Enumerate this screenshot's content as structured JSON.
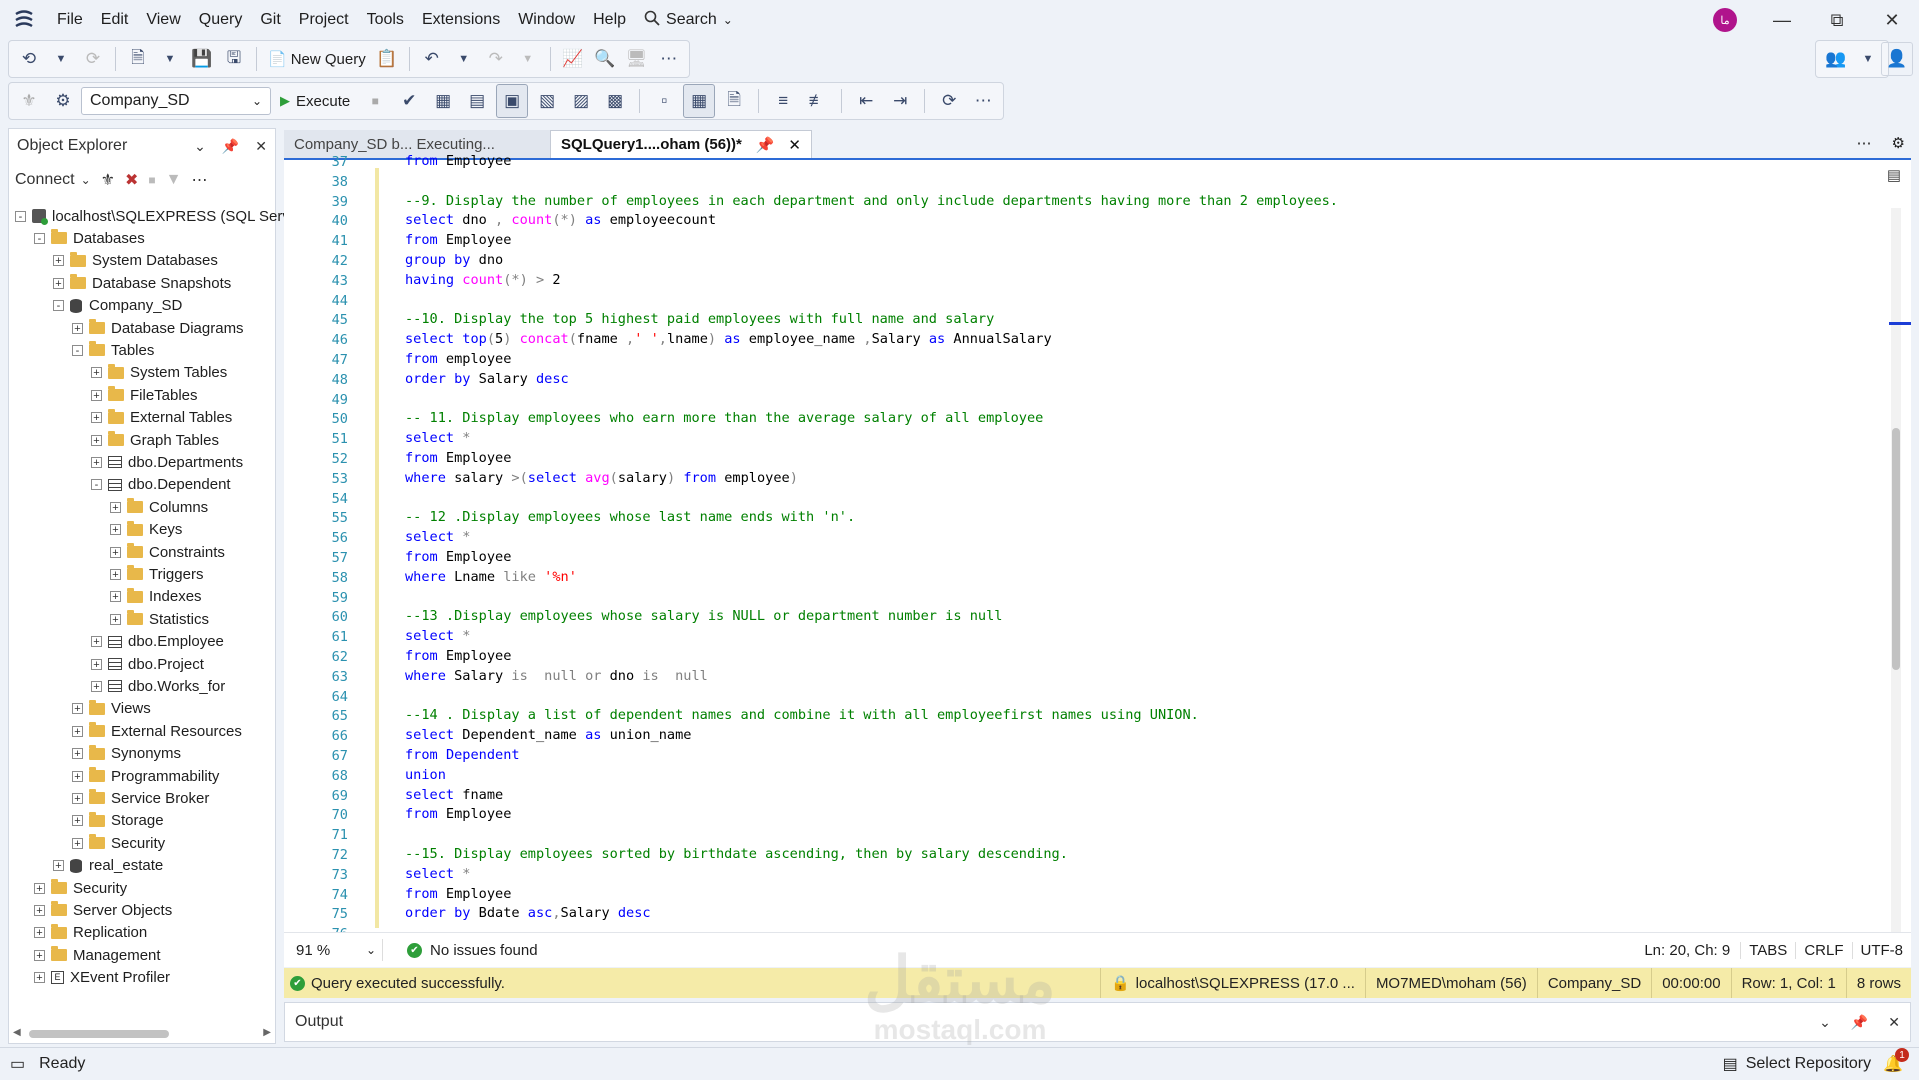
{
  "menu": {
    "items": [
      "File",
      "Edit",
      "View",
      "Query",
      "Git",
      "Project",
      "Tools",
      "Extensions",
      "Window",
      "Help"
    ],
    "search_label": "Search"
  },
  "user": {
    "avatar_initials": "ما"
  },
  "toolbar": {
    "new_query_label": "New Query",
    "database_selected": "Company_SD",
    "execute_label": "Execute"
  },
  "object_explorer": {
    "title": "Object Explorer",
    "connect_label": "Connect",
    "tree": [
      {
        "label": "localhost\\SQLEXPRESS (SQL Serve",
        "icon": "server-icon",
        "level": 0,
        "state": "-"
      },
      {
        "label": "Databases",
        "icon": "folder-icon",
        "level": 1,
        "state": "-"
      },
      {
        "label": "System Databases",
        "icon": "folder-icon",
        "level": 2,
        "state": "+"
      },
      {
        "label": "Database Snapshots",
        "icon": "folder-icon",
        "level": 2,
        "state": "+"
      },
      {
        "label": "Company_SD",
        "icon": "database-icon",
        "level": 2,
        "state": "-"
      },
      {
        "label": "Database Diagrams",
        "icon": "folder-icon",
        "level": 3,
        "state": "+"
      },
      {
        "label": "Tables",
        "icon": "folder-icon",
        "level": 3,
        "state": "-"
      },
      {
        "label": "System Tables",
        "icon": "folder-icon",
        "level": 4,
        "state": "+"
      },
      {
        "label": "FileTables",
        "icon": "folder-icon",
        "level": 4,
        "state": "+"
      },
      {
        "label": "External Tables",
        "icon": "folder-icon",
        "level": 4,
        "state": "+"
      },
      {
        "label": "Graph Tables",
        "icon": "folder-icon",
        "level": 4,
        "state": "+"
      },
      {
        "label": "dbo.Departments",
        "icon": "table-icon",
        "level": 4,
        "state": "+"
      },
      {
        "label": "dbo.Dependent",
        "icon": "table-icon",
        "level": 4,
        "state": "-"
      },
      {
        "label": "Columns",
        "icon": "folder-icon",
        "level": 5,
        "state": "+"
      },
      {
        "label": "Keys",
        "icon": "folder-icon",
        "level": 5,
        "state": "+"
      },
      {
        "label": "Constraints",
        "icon": "folder-icon",
        "level": 5,
        "state": "+"
      },
      {
        "label": "Triggers",
        "icon": "folder-icon",
        "level": 5,
        "state": "+"
      },
      {
        "label": "Indexes",
        "icon": "folder-icon",
        "level": 5,
        "state": "+"
      },
      {
        "label": "Statistics",
        "icon": "folder-icon",
        "level": 5,
        "state": "+"
      },
      {
        "label": "dbo.Employee",
        "icon": "table-icon",
        "level": 4,
        "state": "+"
      },
      {
        "label": "dbo.Project",
        "icon": "table-icon",
        "level": 4,
        "state": "+"
      },
      {
        "label": "dbo.Works_for",
        "icon": "table-icon",
        "level": 4,
        "state": "+"
      },
      {
        "label": "Views",
        "icon": "folder-icon",
        "level": 3,
        "state": "+"
      },
      {
        "label": "External Resources",
        "icon": "folder-icon",
        "level": 3,
        "state": "+"
      },
      {
        "label": "Synonyms",
        "icon": "folder-icon",
        "level": 3,
        "state": "+"
      },
      {
        "label": "Programmability",
        "icon": "folder-icon",
        "level": 3,
        "state": "+"
      },
      {
        "label": "Service Broker",
        "icon": "folder-icon",
        "level": 3,
        "state": "+"
      },
      {
        "label": "Storage",
        "icon": "folder-icon",
        "level": 3,
        "state": "+"
      },
      {
        "label": "Security",
        "icon": "folder-icon",
        "level": 3,
        "state": "+"
      },
      {
        "label": "real_estate",
        "icon": "database-icon",
        "level": 2,
        "state": "+"
      },
      {
        "label": "Security",
        "icon": "folder-icon",
        "level": 1,
        "state": "+"
      },
      {
        "label": "Server Objects",
        "icon": "folder-icon",
        "level": 1,
        "state": "+"
      },
      {
        "label": "Replication",
        "icon": "folder-icon",
        "level": 1,
        "state": "+"
      },
      {
        "label": "Management",
        "icon": "folder-icon",
        "level": 1,
        "state": "+"
      },
      {
        "label": "XEvent Profiler",
        "icon": "xevent-icon",
        "level": 1,
        "state": "+"
      }
    ]
  },
  "tabs": [
    {
      "label": "Company_SD b... Executing...",
      "active": false
    },
    {
      "label": "SQLQuery1....oham (56))*",
      "active": true
    }
  ],
  "editor": {
    "lines": [
      {
        "n": 37,
        "tokens": [
          [
            "kw",
            "from"
          ],
          [
            "t",
            " Employee"
          ]
        ]
      },
      {
        "n": 38,
        "tokens": []
      },
      {
        "n": 39,
        "tokens": [
          [
            "cm",
            "--9. Display the number of employees in each department and only include departments having more than 2 employees."
          ]
        ]
      },
      {
        "n": 40,
        "tokens": [
          [
            "kw",
            "select"
          ],
          [
            "t",
            " dno "
          ],
          [
            "gr",
            ","
          ],
          [
            "t",
            " "
          ],
          [
            "fn",
            "count"
          ],
          [
            "gr",
            "(*)"
          ],
          [
            "t",
            " "
          ],
          [
            "kw",
            "as"
          ],
          [
            "t",
            " employeecount"
          ]
        ]
      },
      {
        "n": 41,
        "tokens": [
          [
            "kw",
            "from"
          ],
          [
            "t",
            " Employee"
          ]
        ]
      },
      {
        "n": 42,
        "tokens": [
          [
            "kw",
            "group by"
          ],
          [
            "t",
            " dno"
          ]
        ]
      },
      {
        "n": 43,
        "tokens": [
          [
            "kw",
            "having"
          ],
          [
            "t",
            " "
          ],
          [
            "fn",
            "count"
          ],
          [
            "gr",
            "(*)"
          ],
          [
            "t",
            " "
          ],
          [
            "gr",
            ">"
          ],
          [
            "t",
            " 2"
          ]
        ]
      },
      {
        "n": 44,
        "tokens": []
      },
      {
        "n": 45,
        "tokens": [
          [
            "cm",
            "--10. Display the top 5 highest paid employees with full name and salary"
          ]
        ]
      },
      {
        "n": 46,
        "tokens": [
          [
            "kw",
            "select"
          ],
          [
            "t",
            " "
          ],
          [
            "kw",
            "top"
          ],
          [
            "gr",
            "("
          ],
          [
            "t",
            "5"
          ],
          [
            "gr",
            ")"
          ],
          [
            "t",
            " "
          ],
          [
            "fn",
            "concat"
          ],
          [
            "gr",
            "("
          ],
          [
            "t",
            "fname "
          ],
          [
            "gr",
            ","
          ],
          [
            "str",
            "' '"
          ],
          [
            "gr",
            ","
          ],
          [
            "t",
            "lname"
          ],
          [
            "gr",
            ")"
          ],
          [
            "t",
            " "
          ],
          [
            "kw",
            "as"
          ],
          [
            "t",
            " employee_name "
          ],
          [
            "gr",
            ","
          ],
          [
            "t",
            "Salary "
          ],
          [
            "kw",
            "as"
          ],
          [
            "t",
            " AnnualSalary"
          ]
        ]
      },
      {
        "n": 47,
        "tokens": [
          [
            "kw",
            "from"
          ],
          [
            "t",
            " employee"
          ]
        ]
      },
      {
        "n": 48,
        "tokens": [
          [
            "kw",
            "order by"
          ],
          [
            "t",
            " Salary "
          ],
          [
            "kw",
            "desc"
          ]
        ]
      },
      {
        "n": 49,
        "tokens": []
      },
      {
        "n": 50,
        "tokens": [
          [
            "cm",
            "-- 11. Display employees who earn more than the average salary of all employee"
          ]
        ]
      },
      {
        "n": 51,
        "tokens": [
          [
            "kw",
            "select"
          ],
          [
            "t",
            " "
          ],
          [
            "gr",
            "*"
          ]
        ]
      },
      {
        "n": 52,
        "tokens": [
          [
            "kw",
            "from"
          ],
          [
            "t",
            " Employee"
          ]
        ]
      },
      {
        "n": 53,
        "tokens": [
          [
            "kw",
            "where"
          ],
          [
            "t",
            " salary "
          ],
          [
            "gr",
            ">("
          ],
          [
            "kw",
            "select"
          ],
          [
            "t",
            " "
          ],
          [
            "fn",
            "avg"
          ],
          [
            "gr",
            "("
          ],
          [
            "t",
            "salary"
          ],
          [
            "gr",
            ")"
          ],
          [
            "t",
            " "
          ],
          [
            "kw",
            "from"
          ],
          [
            "t",
            " employee"
          ],
          [
            "gr",
            ")"
          ]
        ]
      },
      {
        "n": 54,
        "tokens": []
      },
      {
        "n": 55,
        "tokens": [
          [
            "cm",
            "-- 12 .Display employees whose last name ends with 'n'."
          ]
        ]
      },
      {
        "n": 56,
        "tokens": [
          [
            "kw",
            "select"
          ],
          [
            "t",
            " "
          ],
          [
            "gr",
            "*"
          ]
        ]
      },
      {
        "n": 57,
        "tokens": [
          [
            "kw",
            "from"
          ],
          [
            "t",
            " Employee"
          ]
        ]
      },
      {
        "n": 58,
        "tokens": [
          [
            "kw",
            "where"
          ],
          [
            "t",
            " Lname "
          ],
          [
            "gr",
            "like"
          ],
          [
            "t",
            " "
          ],
          [
            "str",
            "'%n'"
          ]
        ]
      },
      {
        "n": 59,
        "tokens": []
      },
      {
        "n": 60,
        "tokens": [
          [
            "cm",
            "--13 .Display employees whose salary is NULL or department number is null"
          ]
        ]
      },
      {
        "n": 61,
        "tokens": [
          [
            "kw",
            "select"
          ],
          [
            "t",
            " "
          ],
          [
            "gr",
            "*"
          ]
        ]
      },
      {
        "n": 62,
        "tokens": [
          [
            "kw",
            "from"
          ],
          [
            "t",
            " Employee"
          ]
        ]
      },
      {
        "n": 63,
        "tokens": [
          [
            "kw",
            "where"
          ],
          [
            "t",
            " Salary "
          ],
          [
            "gr",
            "is  null or"
          ],
          [
            "t",
            " dno "
          ],
          [
            "gr",
            "is  null"
          ]
        ]
      },
      {
        "n": 64,
        "tokens": []
      },
      {
        "n": 65,
        "tokens": [
          [
            "cm",
            "--14 . Display a list of dependent names and combine it with all employeefirst names using UNION."
          ]
        ]
      },
      {
        "n": 66,
        "tokens": [
          [
            "kw",
            "select"
          ],
          [
            "t",
            " Dependent_name "
          ],
          [
            "kw",
            "as"
          ],
          [
            "t",
            " union_name"
          ]
        ]
      },
      {
        "n": 67,
        "tokens": [
          [
            "kw",
            "from"
          ],
          [
            "t",
            " "
          ],
          [
            "kw",
            "Dependent"
          ]
        ]
      },
      {
        "n": 68,
        "tokens": [
          [
            "kw",
            "union"
          ]
        ]
      },
      {
        "n": 69,
        "tokens": [
          [
            "kw",
            "select"
          ],
          [
            "t",
            " fname"
          ]
        ]
      },
      {
        "n": 70,
        "tokens": [
          [
            "kw",
            "from"
          ],
          [
            "t",
            " Employee"
          ]
        ]
      },
      {
        "n": 71,
        "tokens": []
      },
      {
        "n": 72,
        "tokens": [
          [
            "cm",
            "--15. Display employees sorted by birthdate ascending, then by salary descending."
          ]
        ]
      },
      {
        "n": 73,
        "tokens": [
          [
            "kw",
            "select"
          ],
          [
            "t",
            " "
          ],
          [
            "gr",
            "*"
          ]
        ]
      },
      {
        "n": 74,
        "tokens": [
          [
            "kw",
            "from"
          ],
          [
            "t",
            " Employee"
          ]
        ]
      },
      {
        "n": 75,
        "tokens": [
          [
            "kw",
            "order by"
          ],
          [
            "t",
            " Bdate "
          ],
          [
            "kw",
            "asc"
          ],
          [
            "gr",
            ","
          ],
          [
            "t",
            "Salary "
          ],
          [
            "kw",
            "desc"
          ]
        ]
      },
      {
        "n": 76,
        "tokens": []
      }
    ],
    "colors": {
      "keyword": "#0000ff",
      "function": "#ff00ff",
      "comment": "#008000",
      "string": "#ff0000",
      "operator": "#808080",
      "line_number": "#2b91af"
    }
  },
  "editor_footer": {
    "zoom": "91 %",
    "issues": "No issues found",
    "position": "Ln: 20, Ch: 9",
    "indent": "TABS",
    "line_ending": "CRLF",
    "encoding": "UTF-8"
  },
  "query_status": {
    "message": "Query executed successfully.",
    "server": "localhost\\SQLEXPRESS (17.0 ...",
    "user": "MO7MED\\moham (56)",
    "database": "Company_SD",
    "elapsed": "00:00:00",
    "rowcol": "Row: 1, Col: 1",
    "rows": "8 rows"
  },
  "output": {
    "title": "Output"
  },
  "statusbar": {
    "ready": "Ready",
    "repo": "Select Repository",
    "notification_count": "1"
  },
  "watermark": {
    "line1": "مستقل",
    "line2": "mostaql.com"
  }
}
